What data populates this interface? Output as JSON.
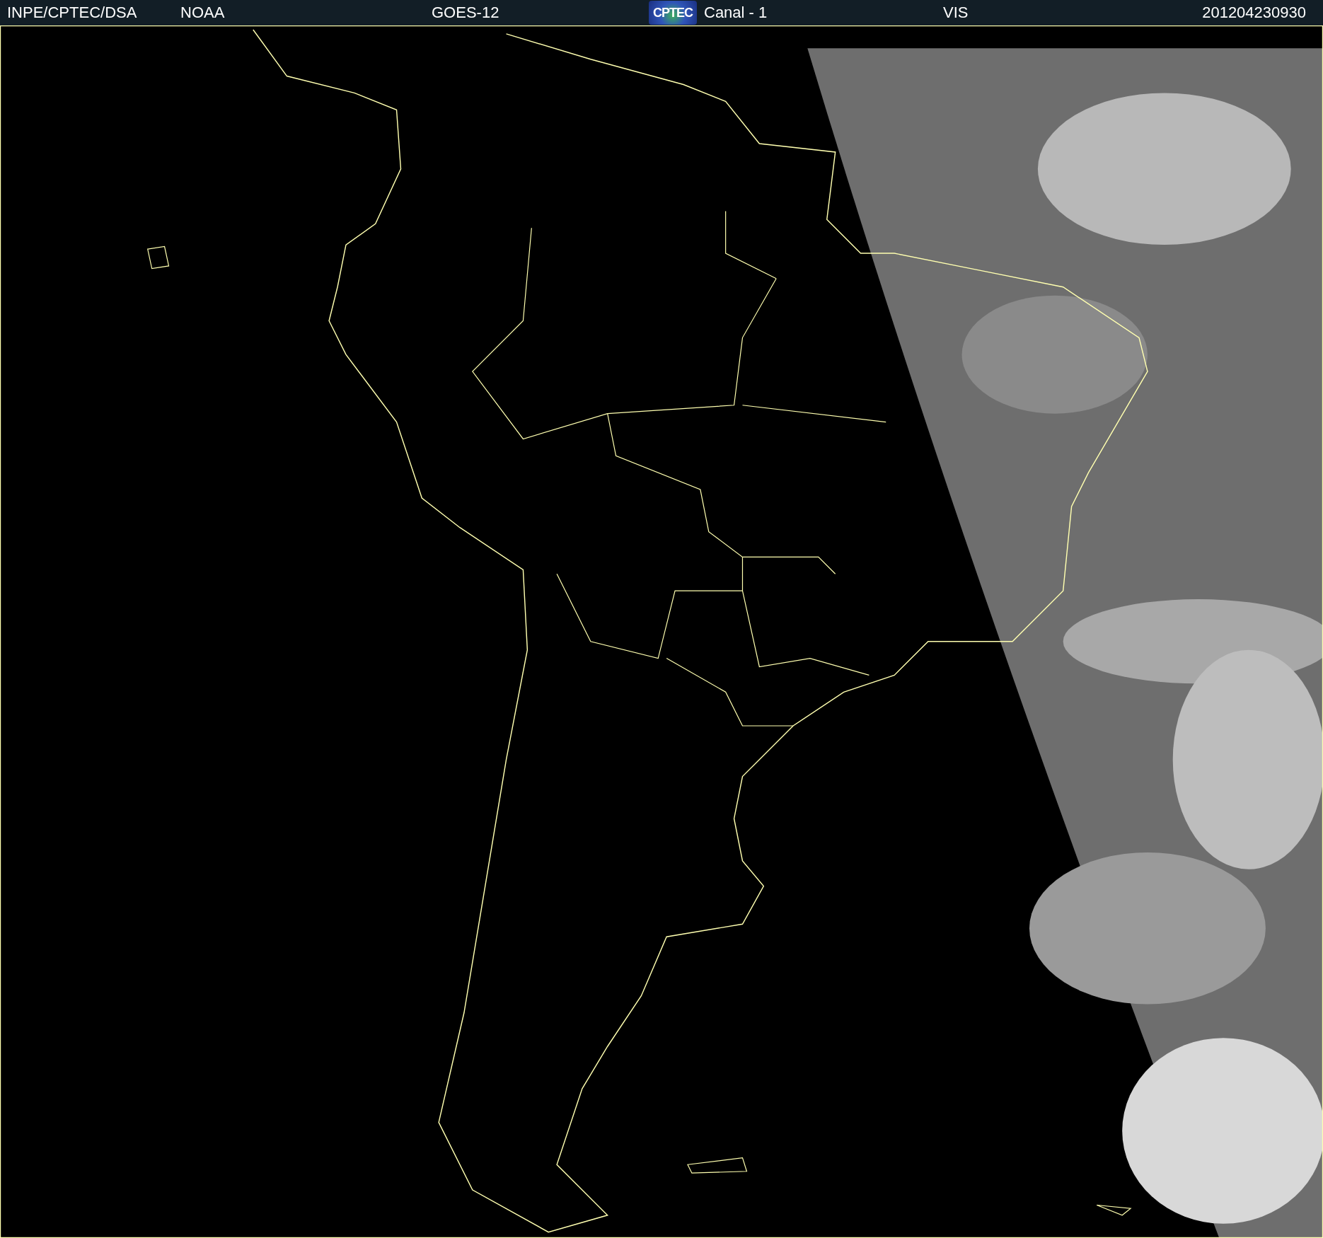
{
  "header": {
    "items": [
      {
        "kind": "text",
        "text": "INPE/CPTEC/DSA"
      },
      {
        "kind": "text",
        "text": "NOAA"
      },
      {
        "kind": "text",
        "text": "GOES-12"
      },
      {
        "kind": "logo",
        "text": "CPTEC"
      },
      {
        "kind": "text",
        "text": "Canal - 1"
      },
      {
        "kind": "text",
        "text": "VIS"
      },
      {
        "kind": "text",
        "text": "201204230930"
      }
    ]
  }
}
